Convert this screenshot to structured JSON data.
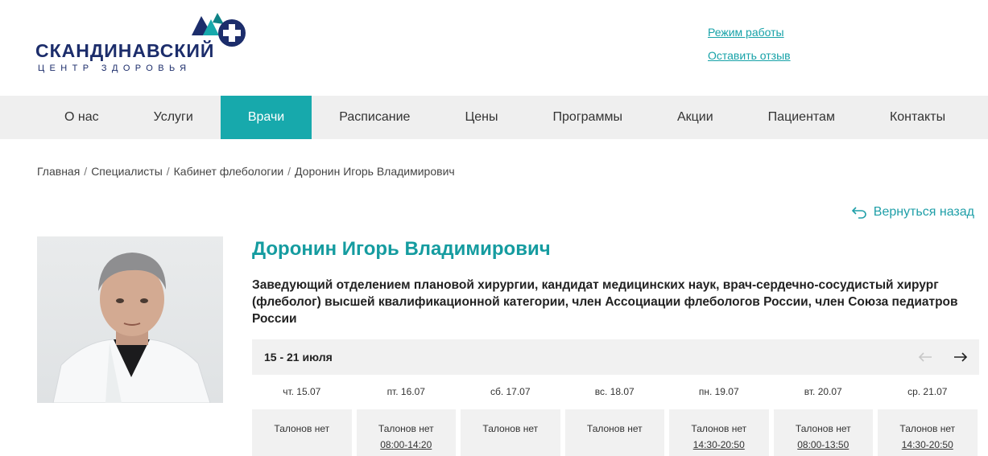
{
  "brand": {
    "title": "СКАНДИНАВСКИЙ",
    "subtitle": "ЦЕНТР ЗДОРОВЬЯ",
    "colors": {
      "navy": "#1c2d6b",
      "teal": "#17a9ac",
      "dark_teal": "#0e8286"
    }
  },
  "top_links": {
    "hours": "Режим работы",
    "review": "Оставить отзыв"
  },
  "nav": {
    "items": [
      {
        "label": "О нас"
      },
      {
        "label": "Услуги"
      },
      {
        "label": "Врачи",
        "active": true
      },
      {
        "label": "Расписание"
      },
      {
        "label": "Цены"
      },
      {
        "label": "Программы"
      },
      {
        "label": "Акции"
      },
      {
        "label": "Пациентам"
      },
      {
        "label": "Контакты"
      }
    ]
  },
  "breadcrumb": {
    "items": [
      "Главная",
      "Специалисты",
      "Кабинет флебологии",
      "Доронин Игорь Владимирович"
    ],
    "separator": "/"
  },
  "back_link": {
    "label": "Вернуться назад",
    "icon": "return-arrow-icon"
  },
  "doctor": {
    "name": "Доронин Игорь Владимирович",
    "description": "Заведующий отделением плановой хирургии, кандидат медицинских наук, врач-сердечно-сосудистый хирург (флеболог) высшей квалификационной категории, член Ассоциации флебологов России, член Союза педиатров России"
  },
  "schedule": {
    "week": "15 - 21 июля",
    "days": [
      {
        "label": "чт. 15.07",
        "status": "Талонов нет",
        "hours": ""
      },
      {
        "label": "пт. 16.07",
        "status": "Талонов нет",
        "hours": "08:00-14:20"
      },
      {
        "label": "сб. 17.07",
        "status": "Талонов нет",
        "hours": ""
      },
      {
        "label": "вс. 18.07",
        "status": "Талонов нет",
        "hours": ""
      },
      {
        "label": "пн. 19.07",
        "status": "Талонов нет",
        "hours": "14:30-20:50"
      },
      {
        "label": "вт. 20.07",
        "status": "Талонов нет",
        "hours": "08:00-13:50"
      },
      {
        "label": "ср. 21.07",
        "status": "Талонов нет",
        "hours": "14:30-20:50"
      }
    ]
  }
}
